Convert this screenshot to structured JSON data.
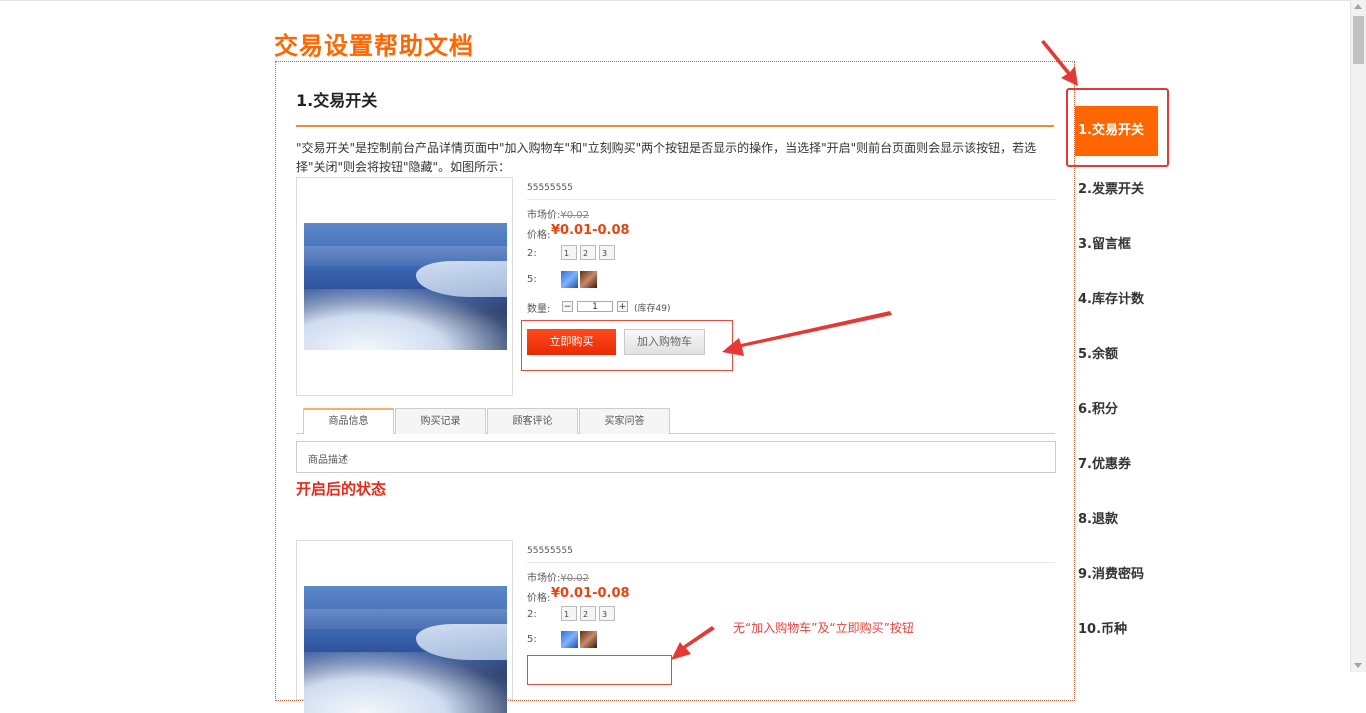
{
  "page": {
    "title": "交易设置帮助文档"
  },
  "section": {
    "heading": "1.交易开关",
    "description": "\"交易开关\"是控制前台产品详情页面中\"加入购物车\"和\"立刻购买\"两个按钮是否显示的操作，当选择\"开启\"则前台页面则会显示该按钮，若选择\"关闭\"则会将按钮\"隐藏\"。如图所示："
  },
  "demo1": {
    "code": "55555555",
    "market_label": "市场价:",
    "market_price": "¥0.02",
    "price_label": "价格:",
    "price": "¥0.01-0.08",
    "attr1_label": "2:",
    "thumbs": [
      "1",
      "2",
      "3"
    ],
    "attr2_label": "5:",
    "qty_label": "数量:",
    "qty_minus": "−",
    "qty_value": "1",
    "qty_plus": "+",
    "stock": "(库存49)",
    "buy_button": "立即购买",
    "cart_button": "加入购物车",
    "tabs": [
      "商品信息",
      "购买记录",
      "顾客评论",
      "买家问答"
    ],
    "tab_content": "商品描述"
  },
  "state_label": "开启后的状态",
  "demo2": {
    "code": "55555555",
    "market_label": "市场价:",
    "market_price": "¥0.02",
    "price_label": "价格:",
    "price": "¥0.01-0.08",
    "attr1_label": "2:",
    "thumbs": [
      "1",
      "2",
      "3"
    ],
    "attr2_label": "5:",
    "note": "无“加入购物车”及“立即购买”按钮"
  },
  "sidebar": {
    "items": [
      "1.交易开关",
      "2.发票开关",
      "3.留言框",
      "4.库存计数",
      "5.余额",
      "6.积分",
      "7.优惠券",
      "8.退款",
      "9.消费密码",
      "10.币种"
    ],
    "active_index": 0
  },
  "colors": {
    "accent": "#ff6600",
    "annotation_red": "#e53935",
    "price_red": "#e8440f"
  }
}
